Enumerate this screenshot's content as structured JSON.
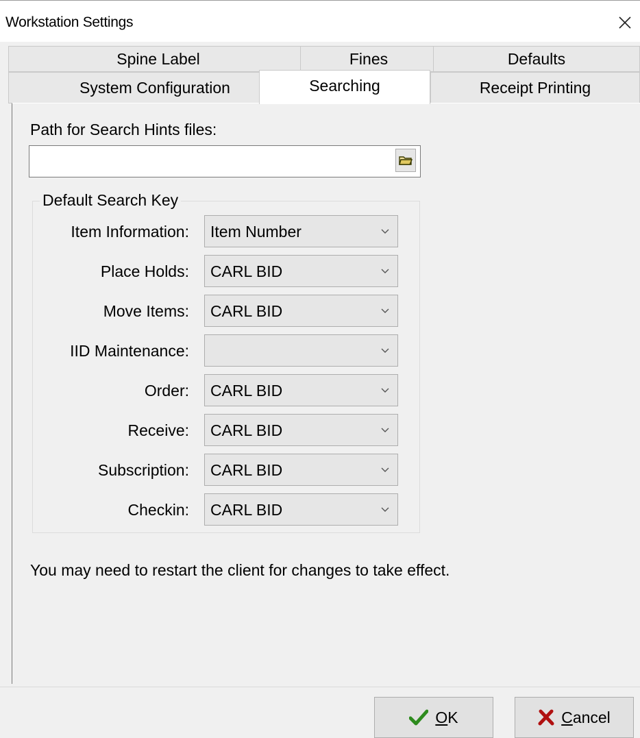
{
  "window": {
    "title": "Workstation Settings"
  },
  "tabs_row1": [
    {
      "label": "Spine Label"
    },
    {
      "label": "Fines"
    },
    {
      "label": "Defaults"
    }
  ],
  "tabs_row2": [
    {
      "label": "System Configuration"
    },
    {
      "label": "Searching",
      "active": true
    },
    {
      "label": "Receipt Printing"
    }
  ],
  "search_hints": {
    "label": "Path for Search Hints files:",
    "value": "",
    "browse_icon": "folder-icon"
  },
  "default_search_key": {
    "title": "Default Search Key",
    "fields": [
      {
        "label": "Item Information:",
        "value": "Item Number"
      },
      {
        "label": "Place Holds:",
        "value": "CARL BID"
      },
      {
        "label": "Move Items:",
        "value": "CARL BID"
      },
      {
        "label": "IID Maintenance:",
        "value": ""
      },
      {
        "label": "Order:",
        "value": "CARL BID"
      },
      {
        "label": "Receive:",
        "value": "CARL BID"
      },
      {
        "label": "Subscription:",
        "value": "CARL BID"
      },
      {
        "label": "Checkin:",
        "value": "CARL BID"
      }
    ]
  },
  "notice": "You may need to restart the client for changes to take effect.",
  "buttons": {
    "ok": {
      "accel": "O",
      "rest": "K",
      "icon": "checkmark-icon",
      "icon_color": "#2e8b1e"
    },
    "cancel": {
      "accel": "C",
      "rest": "ancel",
      "icon": "x-icon",
      "icon_color": "#b01010"
    }
  }
}
